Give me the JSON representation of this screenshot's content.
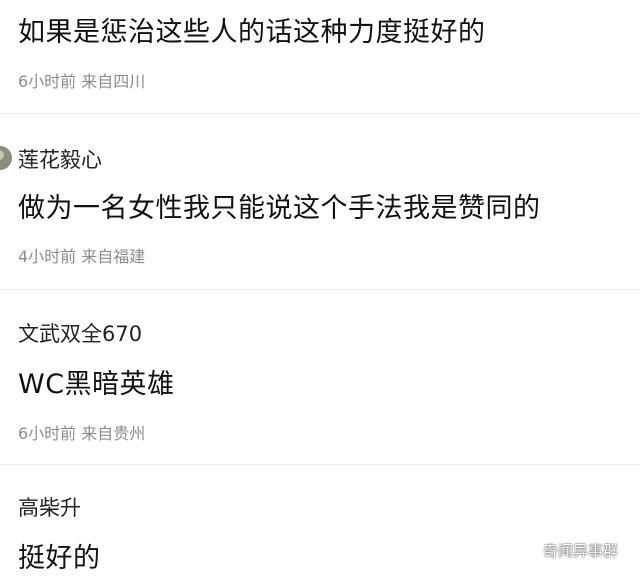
{
  "comments": [
    {
      "username": "",
      "text": "如果是惩治这些人的话这种力度挺好的",
      "meta": "6小时前 来自四川"
    },
    {
      "username": "莲花毅心",
      "text": "做为一名女性我只能说这个手法我是赞同的",
      "meta": "4小时前 来自福建"
    },
    {
      "username": "文武双全670",
      "text": "WC黑暗英雄",
      "meta": "6小时前 来自贵州"
    },
    {
      "username": "高柴升",
      "text": "挺好的",
      "meta": ""
    }
  ],
  "watermark": {
    "text": "奇闻异事群",
    "icon": "wechat-icon"
  }
}
